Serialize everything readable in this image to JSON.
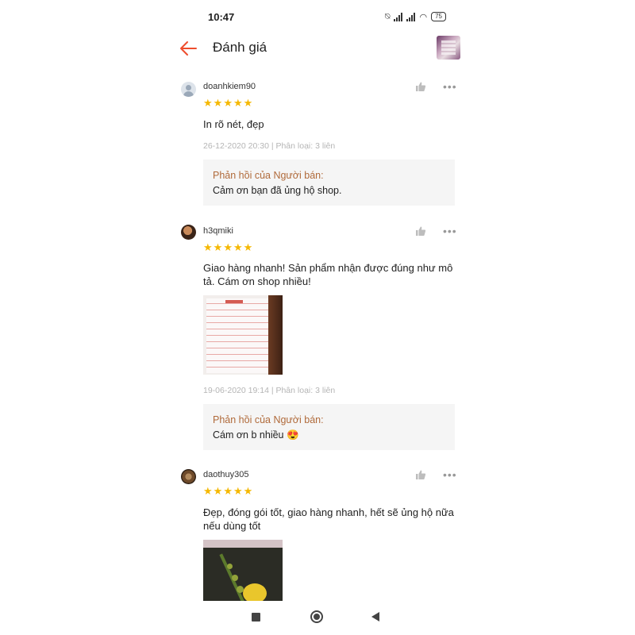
{
  "status_bar": {
    "time": "10:47",
    "battery": "75"
  },
  "header": {
    "title": "Đánh giá",
    "accent_color": "#ee4d2d"
  },
  "reviews": [
    {
      "username": "doanhkiem90",
      "rating": 5,
      "stars": "★★★★★",
      "comment": "In rõ nét, đẹp",
      "meta": "26-12-2020 20:30 | Phân loại: 3 liên",
      "reply_title": "Phản hồi của Người bán:",
      "reply_text": "Cảm ơn bạn đã ủng hộ shop."
    },
    {
      "username": "h3qmiki",
      "rating": 5,
      "stars": "★★★★★",
      "comment": "Giao hàng nhanh! Sản phẩm nhận được đúng như mô tả. Cám ơn shop nhiều!",
      "meta": "19-06-2020 19:14 | Phân loại: 3 liên",
      "reply_title": "Phản hồi của Người bán:",
      "reply_text": "Cám ơn b nhiều 😍"
    },
    {
      "username": "daothuy305",
      "rating": 5,
      "stars": "★★★★★",
      "comment": "Đẹp, đóng gói tốt, giao hàng nhanh, hết sẽ ủng hộ nữa nếu dùng tốt"
    }
  ],
  "icons": {
    "back": "arrow-left-icon",
    "like": "thumbs-up-icon",
    "more": "more-dots-icon",
    "star": "star-icon"
  }
}
